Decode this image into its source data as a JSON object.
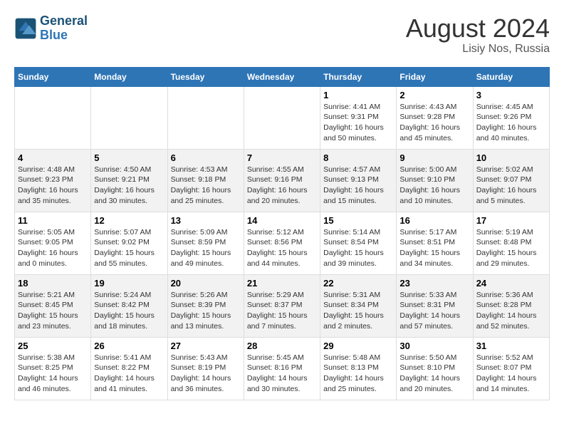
{
  "header": {
    "logo_line1": "General",
    "logo_line2": "Blue",
    "main_title": "August 2024",
    "sub_title": "Lisiy Nos, Russia"
  },
  "days_of_week": [
    "Sunday",
    "Monday",
    "Tuesday",
    "Wednesday",
    "Thursday",
    "Friday",
    "Saturday"
  ],
  "weeks": [
    [
      {
        "day": "",
        "content": ""
      },
      {
        "day": "",
        "content": ""
      },
      {
        "day": "",
        "content": ""
      },
      {
        "day": "",
        "content": ""
      },
      {
        "day": "1",
        "content": "Sunrise: 4:41 AM\nSunset: 9:31 PM\nDaylight: 16 hours\nand 50 minutes."
      },
      {
        "day": "2",
        "content": "Sunrise: 4:43 AM\nSunset: 9:28 PM\nDaylight: 16 hours\nand 45 minutes."
      },
      {
        "day": "3",
        "content": "Sunrise: 4:45 AM\nSunset: 9:26 PM\nDaylight: 16 hours\nand 40 minutes."
      }
    ],
    [
      {
        "day": "4",
        "content": "Sunrise: 4:48 AM\nSunset: 9:23 PM\nDaylight: 16 hours\nand 35 minutes."
      },
      {
        "day": "5",
        "content": "Sunrise: 4:50 AM\nSunset: 9:21 PM\nDaylight: 16 hours\nand 30 minutes."
      },
      {
        "day": "6",
        "content": "Sunrise: 4:53 AM\nSunset: 9:18 PM\nDaylight: 16 hours\nand 25 minutes."
      },
      {
        "day": "7",
        "content": "Sunrise: 4:55 AM\nSunset: 9:16 PM\nDaylight: 16 hours\nand 20 minutes."
      },
      {
        "day": "8",
        "content": "Sunrise: 4:57 AM\nSunset: 9:13 PM\nDaylight: 16 hours\nand 15 minutes."
      },
      {
        "day": "9",
        "content": "Sunrise: 5:00 AM\nSunset: 9:10 PM\nDaylight: 16 hours\nand 10 minutes."
      },
      {
        "day": "10",
        "content": "Sunrise: 5:02 AM\nSunset: 9:07 PM\nDaylight: 16 hours\nand 5 minutes."
      }
    ],
    [
      {
        "day": "11",
        "content": "Sunrise: 5:05 AM\nSunset: 9:05 PM\nDaylight: 16 hours\nand 0 minutes."
      },
      {
        "day": "12",
        "content": "Sunrise: 5:07 AM\nSunset: 9:02 PM\nDaylight: 15 hours\nand 55 minutes."
      },
      {
        "day": "13",
        "content": "Sunrise: 5:09 AM\nSunset: 8:59 PM\nDaylight: 15 hours\nand 49 minutes."
      },
      {
        "day": "14",
        "content": "Sunrise: 5:12 AM\nSunset: 8:56 PM\nDaylight: 15 hours\nand 44 minutes."
      },
      {
        "day": "15",
        "content": "Sunrise: 5:14 AM\nSunset: 8:54 PM\nDaylight: 15 hours\nand 39 minutes."
      },
      {
        "day": "16",
        "content": "Sunrise: 5:17 AM\nSunset: 8:51 PM\nDaylight: 15 hours\nand 34 minutes."
      },
      {
        "day": "17",
        "content": "Sunrise: 5:19 AM\nSunset: 8:48 PM\nDaylight: 15 hours\nand 29 minutes."
      }
    ],
    [
      {
        "day": "18",
        "content": "Sunrise: 5:21 AM\nSunset: 8:45 PM\nDaylight: 15 hours\nand 23 minutes."
      },
      {
        "day": "19",
        "content": "Sunrise: 5:24 AM\nSunset: 8:42 PM\nDaylight: 15 hours\nand 18 minutes."
      },
      {
        "day": "20",
        "content": "Sunrise: 5:26 AM\nSunset: 8:39 PM\nDaylight: 15 hours\nand 13 minutes."
      },
      {
        "day": "21",
        "content": "Sunrise: 5:29 AM\nSunset: 8:37 PM\nDaylight: 15 hours\nand 7 minutes."
      },
      {
        "day": "22",
        "content": "Sunrise: 5:31 AM\nSunset: 8:34 PM\nDaylight: 15 hours\nand 2 minutes."
      },
      {
        "day": "23",
        "content": "Sunrise: 5:33 AM\nSunset: 8:31 PM\nDaylight: 14 hours\nand 57 minutes."
      },
      {
        "day": "24",
        "content": "Sunrise: 5:36 AM\nSunset: 8:28 PM\nDaylight: 14 hours\nand 52 minutes."
      }
    ],
    [
      {
        "day": "25",
        "content": "Sunrise: 5:38 AM\nSunset: 8:25 PM\nDaylight: 14 hours\nand 46 minutes."
      },
      {
        "day": "26",
        "content": "Sunrise: 5:41 AM\nSunset: 8:22 PM\nDaylight: 14 hours\nand 41 minutes."
      },
      {
        "day": "27",
        "content": "Sunrise: 5:43 AM\nSunset: 8:19 PM\nDaylight: 14 hours\nand 36 minutes."
      },
      {
        "day": "28",
        "content": "Sunrise: 5:45 AM\nSunset: 8:16 PM\nDaylight: 14 hours\nand 30 minutes."
      },
      {
        "day": "29",
        "content": "Sunrise: 5:48 AM\nSunset: 8:13 PM\nDaylight: 14 hours\nand 25 minutes."
      },
      {
        "day": "30",
        "content": "Sunrise: 5:50 AM\nSunset: 8:10 PM\nDaylight: 14 hours\nand 20 minutes."
      },
      {
        "day": "31",
        "content": "Sunrise: 5:52 AM\nSunset: 8:07 PM\nDaylight: 14 hours\nand 14 minutes."
      }
    ]
  ]
}
